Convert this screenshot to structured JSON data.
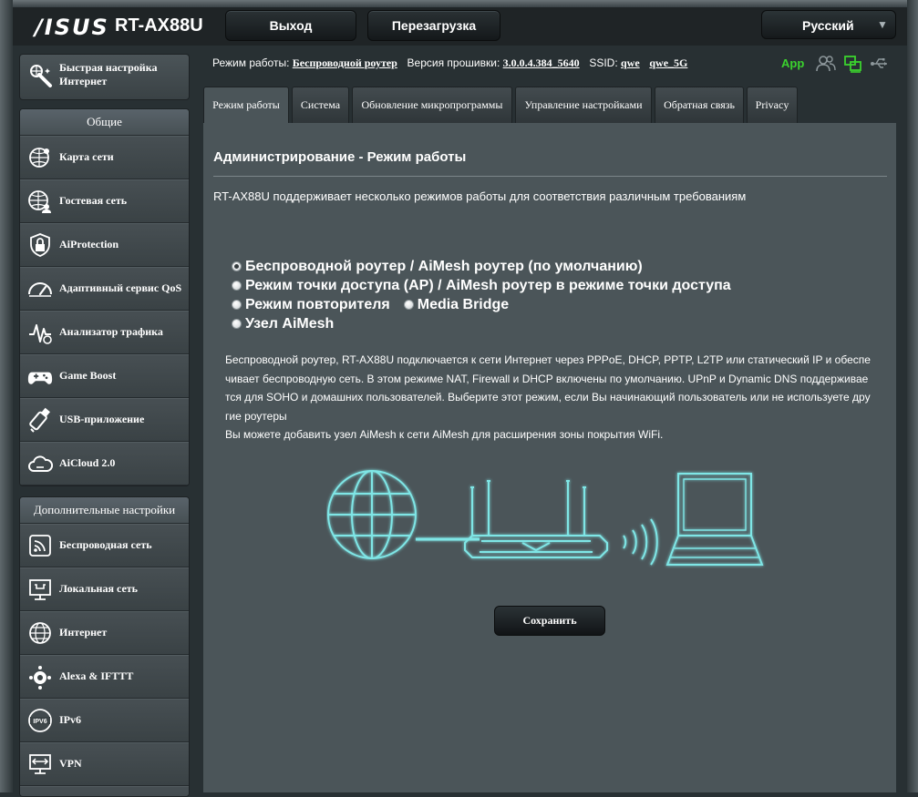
{
  "header": {
    "brand": "/ISUS",
    "model": "RT-AX88U",
    "logout_label": "Выход",
    "reboot_label": "Перезагрузка",
    "language": "Русский"
  },
  "sidebar": {
    "quick_setup": "Быстрая настройка Интернет",
    "general_title": "Общие",
    "general_items": [
      {
        "label": "Карта сети",
        "icon": "network-map-icon"
      },
      {
        "label": "Гостевая сеть",
        "icon": "guest-network-icon"
      },
      {
        "label": "AiProtection",
        "icon": "shield-lock-icon"
      },
      {
        "label": "Адаптивный сервис QoS",
        "icon": "gauge-icon"
      },
      {
        "label": "Анализатор трафика",
        "icon": "traffic-analyzer-icon"
      },
      {
        "label": "Game Boost",
        "icon": "gamepad-icon"
      },
      {
        "label": "USB-приложение",
        "icon": "usb-icon"
      },
      {
        "label": "AiCloud 2.0",
        "icon": "cloud-icon"
      }
    ],
    "advanced_title": "Дополнительные настройки",
    "advanced_items": [
      {
        "label": "Беспроводная сеть",
        "icon": "wifi-icon"
      },
      {
        "label": "Локальная сеть",
        "icon": "lan-icon"
      },
      {
        "label": "Интернет",
        "icon": "globe-icon"
      },
      {
        "label": "Alexa & IFTTT",
        "icon": "alexa-icon"
      },
      {
        "label": "IPv6",
        "icon": "ipv6-icon"
      },
      {
        "label": "VPN",
        "icon": "vpn-icon"
      }
    ]
  },
  "status": {
    "mode_label": "Режим работы:",
    "mode_value": "Беспроводной роутер",
    "fw_label": "Версия прошивки:",
    "fw_value": "3.0.0.4.384_5640",
    "ssid_label": "SSID:",
    "ssid_1": "qwe",
    "ssid_2": "qwe_5G",
    "app_label": "App"
  },
  "tabs": [
    "Режим работы",
    "Система",
    "Обновление микропрограммы",
    "Управление настройками",
    "Обратная связь",
    "Privacy"
  ],
  "main": {
    "title": "Администрирование - Режим работы",
    "description": "RT-AX88U поддерживает несколько режимов работы для соответствия различным требованиям",
    "modes": {
      "router": "Беспроводной роутер / AiMesh роутер (по умолчанию)",
      "ap": "Режим точки доступа (AP) / AiMesh роутер в режиме точки доступа",
      "repeater": "Режим повторителя",
      "media_bridge": "Media Bridge",
      "aimesh_node": "Узел AiMesh"
    },
    "selected_mode": "router",
    "mode_description_lines": [
      "Беспроводной роутер, RT-AX88U подключается к сети Интернет через PPPoE, DHCP, PPTP, L2TP или статический IP и обеспе",
      "чивает беспроводную сеть. В этом режиме NAT, Firewall и DHCP включены по умолчанию. UPnP и Dynamic DNS поддерживае",
      "тся для SOHO и домашних пользователей. Выберите этот режим, если Вы начинающий пользователь или не используете дру",
      "гие роутеры",
      "Вы можете добавить узел AiMesh к сети AiMesh для расширения зоны покрытия WiFi."
    ],
    "save_label": "Сохранить"
  },
  "colors": {
    "accent_green": "#3bd22e",
    "illustration_cyan": "#7fe6e6",
    "panel_bg": "#4b5559"
  }
}
